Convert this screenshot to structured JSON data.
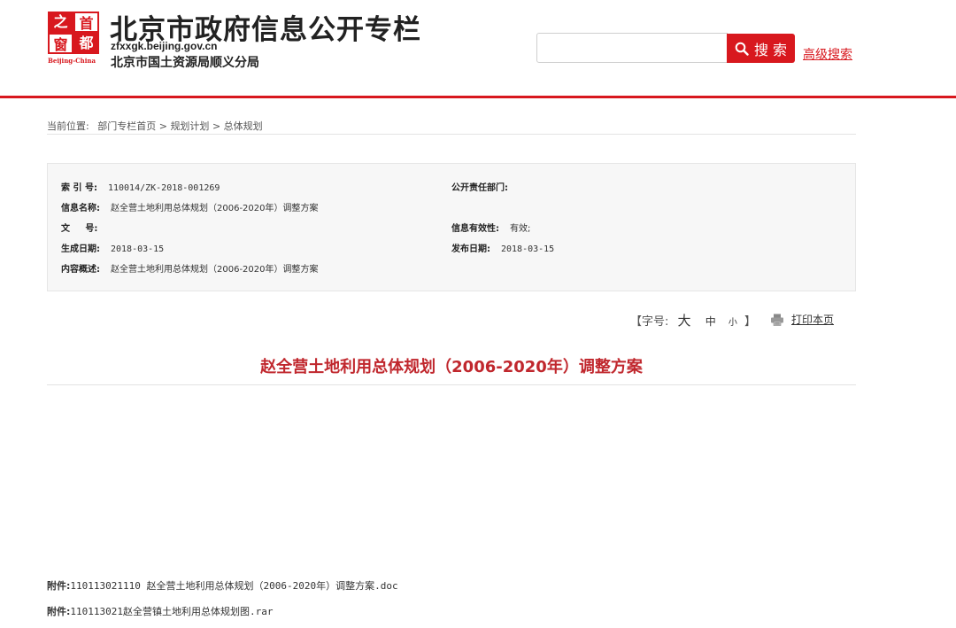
{
  "header": {
    "logo": {
      "seal_chars": [
        "之",
        "首",
        "窗",
        "都"
      ],
      "caption": "Beijing-China"
    },
    "title": "北京市政府信息公开专栏",
    "domain": "zfxxgk.beijing.gov.cn",
    "subtitle": "北京市国土资源局顺义分局",
    "search": {
      "placeholder": "",
      "button_label": "搜 索",
      "icon": "search-icon"
    },
    "advanced_search_label": "高级搜索"
  },
  "breadcrumb": {
    "prefix": "当前位置:",
    "items": [
      "部门专栏首页",
      "规划计划",
      "总体规划"
    ],
    "separator": ">"
  },
  "meta": {
    "index_no_label": "索 引 号:",
    "index_no": "110014/ZK-2018-001269",
    "responsible_dept_label": "公开责任部门:",
    "responsible_dept": "",
    "info_name_label": "信息名称:",
    "info_name": "赵全营土地利用总体规划（2006-2020年）调整方案",
    "doc_no_label": "文     号:",
    "doc_no": "",
    "validity_label": "信息有效性:",
    "validity": "有效;",
    "created_label": "生成日期:",
    "created": "2018-03-15",
    "published_label": "发布日期:",
    "published": "2018-03-15",
    "summary_label": "内容概述:",
    "summary": "赵全营土地利用总体规划（2006-2020年）调整方案"
  },
  "tools": {
    "font_size_open": "【字号:",
    "font_large": "大",
    "font_medium": "中",
    "font_small": "小",
    "font_size_close": "】",
    "print_label": "打印本页",
    "print_icon": "printer-icon"
  },
  "document": {
    "title": "赵全营土地利用总体规划（2006-2020年）调整方案"
  },
  "attachments": [
    {
      "label": "附件:",
      "file": "110113021110 赵全营土地利用总体规划（2006-2020年）调整方案.doc"
    },
    {
      "label": "附件:",
      "file": "110113021赵全营镇土地利用总体规划图.rar"
    }
  ],
  "colors": {
    "brand_red": "#d8181e",
    "title_red": "#c0272d"
  }
}
